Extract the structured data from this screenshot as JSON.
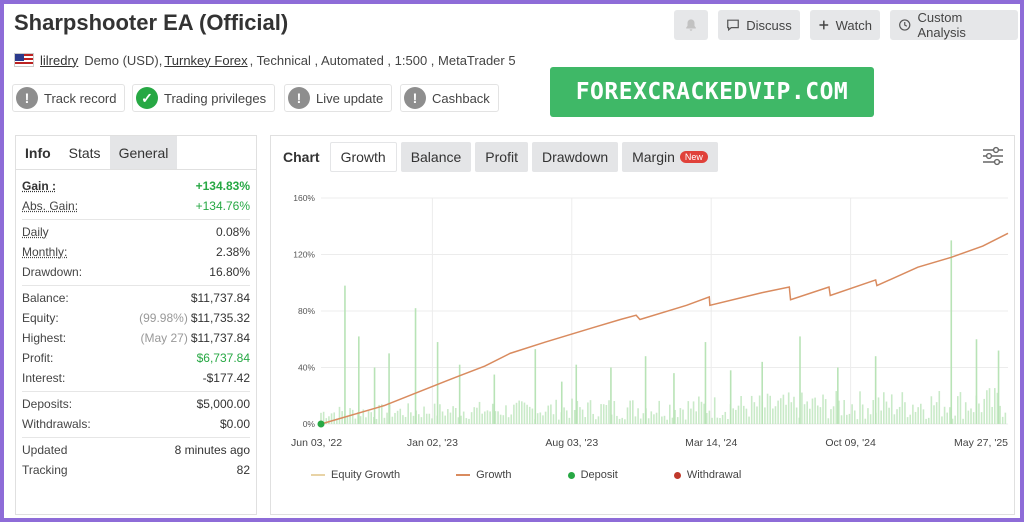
{
  "header": {
    "title": "Sharpshooter EA (Official)",
    "buttons": {
      "discuss": "Discuss",
      "watch": "Watch",
      "custom": "Custom Analysis"
    }
  },
  "account": {
    "user": "lilredry",
    "type": "Demo (USD),",
    "broker": "Turnkey Forex",
    "details": ", Technical , Automated , 1:500 , MetaTrader 5"
  },
  "badges": {
    "track": "Track record",
    "trading": "Trading privileges",
    "live": "Live update",
    "cashback": "Cashback"
  },
  "promo": "FOREXCRACKEDVIP.COM",
  "left_tabs": {
    "info": "Info",
    "stats": "Stats",
    "general": "General"
  },
  "stats": {
    "gain_l": "Gain :",
    "gain_v": "+134.83%",
    "abs_l": "Abs. Gain:",
    "abs_v": "+134.76%",
    "daily_l": "Daily",
    "daily_v": "0.08%",
    "monthly_l": "Monthly:",
    "monthly_v": "2.38%",
    "dd_l": "Drawdown:",
    "dd_v": "16.80%",
    "bal_l": "Balance:",
    "bal_v": "$11,737.84",
    "eq_l": "Equity:",
    "eq_note": "(99.98%)",
    "eq_v": "$11,735.32",
    "hi_l": "Highest:",
    "hi_note": "(May 27)",
    "hi_v": "$11,737.84",
    "pr_l": "Profit:",
    "pr_v": "$6,737.84",
    "in_l": "Interest:",
    "in_v": "-$177.42",
    "dep_l": "Deposits:",
    "dep_v": "$5,000.00",
    "wd_l": "Withdrawals:",
    "wd_v": "$0.00",
    "up_l": "Updated",
    "up_v": "8 minutes ago",
    "tr_l": "Tracking",
    "tr_v": "82"
  },
  "chart_tabs": {
    "chart": "Chart",
    "growth": "Growth",
    "balance": "Balance",
    "profit": "Profit",
    "drawdown": "Drawdown",
    "margin": "Margin",
    "new": "New"
  },
  "colors": {
    "growth": "#d98b5f",
    "equity": "#b8e3b6",
    "deposit": "#27a844",
    "withdrawal": "#c0392b"
  },
  "chart_data": {
    "type": "line",
    "yticks": [
      "0%",
      "40%",
      "80%",
      "120%",
      "160%"
    ],
    "ylim": [
      0,
      160
    ],
    "xticks": [
      "Jun 03, '22",
      "Jan 02, '23",
      "Aug 03, '23",
      "Mar 14, '24",
      "Oct 09, '24",
      "May 27, '25"
    ],
    "xlim": [
      0,
      1090
    ],
    "legend": [
      "Equity Growth",
      "Growth",
      "Deposit",
      "Withdrawal"
    ],
    "series": [
      {
        "name": "Growth",
        "x": [
          0,
          100,
          213,
          260,
          300,
          356,
          430,
          475,
          500,
          506,
          580,
          616,
          617,
          700,
          743,
          745,
          806,
          808,
          880,
          882,
          947,
          1000,
          1050,
          1090
        ],
        "values": [
          0,
          13,
          33,
          41,
          50,
          58,
          68,
          74,
          77,
          74,
          84,
          90,
          84,
          93,
          97,
          88,
          97,
          91,
          102,
          98,
          111,
          118,
          126,
          135
        ]
      },
      {
        "name": "Equity Growth",
        "spikes": [
          [
            38,
            98
          ],
          [
            60,
            62
          ],
          [
            85,
            40
          ],
          [
            108,
            50
          ],
          [
            150,
            82
          ],
          [
            185,
            58
          ],
          [
            220,
            42
          ],
          [
            275,
            35
          ],
          [
            340,
            53
          ],
          [
            382,
            30
          ],
          [
            405,
            42
          ],
          [
            460,
            40
          ],
          [
            515,
            48
          ],
          [
            560,
            36
          ],
          [
            610,
            58
          ],
          [
            650,
            38
          ],
          [
            700,
            44
          ],
          [
            760,
            62
          ],
          [
            820,
            40
          ],
          [
            880,
            48
          ],
          [
            1000,
            130
          ],
          [
            1040,
            60
          ],
          [
            1075,
            52
          ]
        ]
      }
    ],
    "deposit_points": [
      [
        0,
        0
      ]
    ]
  }
}
